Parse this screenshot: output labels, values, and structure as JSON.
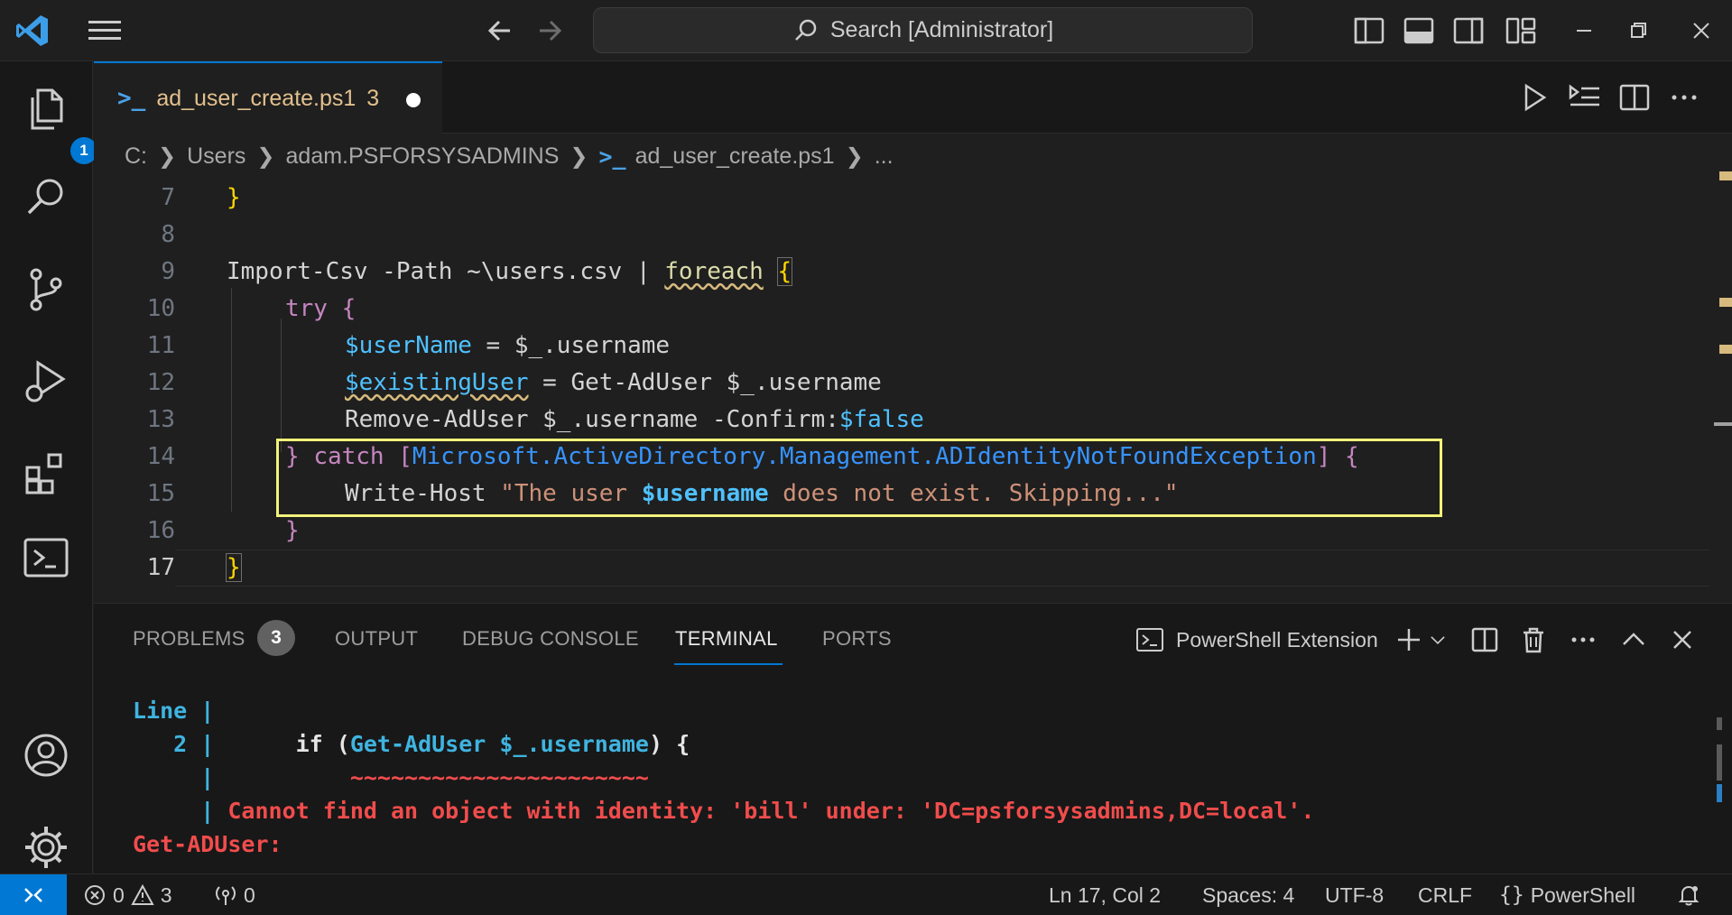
{
  "titlebar": {
    "search_label": "Search [Administrator]"
  },
  "activity_bar": {
    "explorer_badge": "1"
  },
  "tab": {
    "filename": "ad_user_create.ps1",
    "problem_count": "3"
  },
  "breadcrumb": {
    "items": [
      "C:",
      "Users",
      "adam.PSFORSYSADMINS",
      "ad_user_create.ps1",
      "..."
    ]
  },
  "editor": {
    "line_numbers": [
      "7",
      "8",
      "9",
      "10",
      "11",
      "12",
      "13",
      "14",
      "15",
      "16",
      "17"
    ],
    "l7": "}",
    "l9_a": "Import-Csv -Path ~\\users.csv | ",
    "l9_foreach": "foreach",
    "l9_brace": "{",
    "l10_try": "try",
    "l10_brace": "{",
    "l11_var": "$userName",
    "l11_rest": " = $_.username",
    "l12_var": "$existingUser",
    "l12_rest": " = Get-AdUser $_.username",
    "l13_a": "Remove-AdUser $_.username -Confirm:",
    "l13_false": "$false",
    "l14_a": "} ",
    "l14_catch": "catch",
    "l14_open": " [",
    "l14_type": "Microsoft.ActiveDirectory.Management.ADIdentityNotFoundException",
    "l14_close": "] {",
    "l15_cmd": "Write-Host ",
    "l15_str_a": "\"The user ",
    "l15_var": "$username",
    "l15_str_b": " does not exist. Skipping...\"",
    "l16": "}",
    "l17": "}"
  },
  "panel": {
    "tabs": [
      "PROBLEMS",
      "OUTPUT",
      "DEBUG CONSOLE",
      "TERMINAL",
      "PORTS"
    ],
    "problems_count": "3",
    "terminal_profile": "PowerShell Extension"
  },
  "terminal": {
    "line1": "Line |",
    "line2_num": "   2 |",
    "line2_code_a": "      if (",
    "line2_cmd": "Get-AdUser $_.username",
    "line2_code_b": ") {",
    "line3_bar": "     |",
    "line3_tilde": "          ~~~~~~~~~~~~~~~~~~~~~~",
    "line4_bar": "     |",
    "line4_msg": " Cannot find an object with identity: 'bill' under: 'DC=psforsysadmins,DC=local'.",
    "line5": "Get-ADUser:"
  },
  "statusbar": {
    "errors": "0",
    "warnings": "3",
    "ports": "0",
    "position": "Ln 17, Col 2",
    "spaces": "Spaces: 4",
    "encoding": "UTF-8",
    "eol": "CRLF",
    "language": "PowerShell"
  },
  "colors": {
    "accent": "#0078d4",
    "highlight_box": "#f2f27a",
    "error_red": "#f14c4c"
  }
}
